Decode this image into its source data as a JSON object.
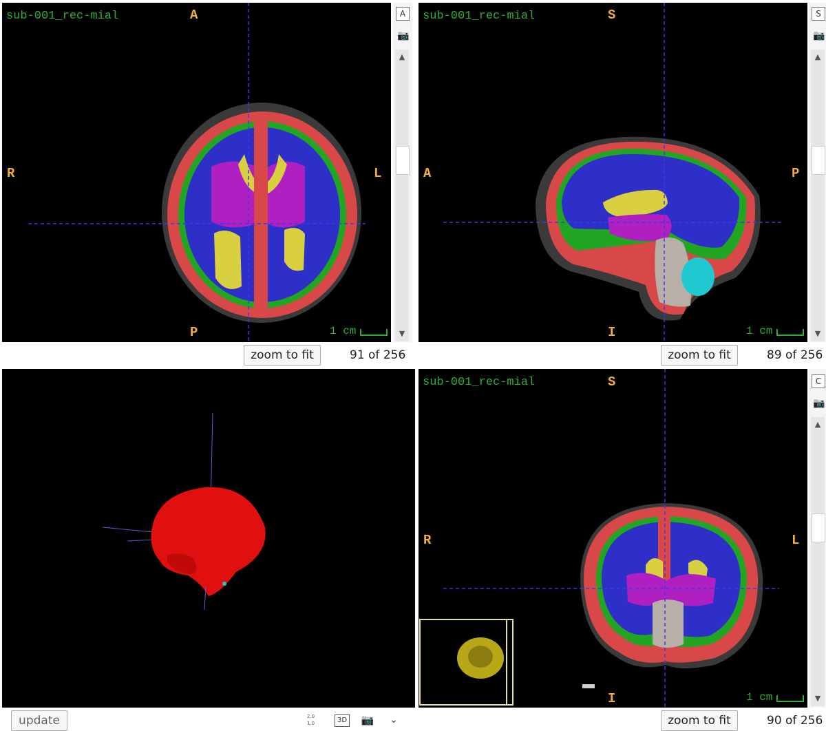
{
  "views": {
    "axial": {
      "title": "sub-001_rec-mial",
      "orient": {
        "top": "A",
        "bottom": "P",
        "left": "R",
        "right": "L"
      },
      "scale_label": "1 cm",
      "side_button": "A",
      "camera_icon": "camera-icon",
      "zoom_label": "zoom to fit",
      "slice": "91 of 256"
    },
    "sagittal": {
      "title": "sub-001_rec-mial",
      "orient": {
        "top": "S",
        "bottom": "I",
        "left": "A",
        "right": "P"
      },
      "scale_label": "1 cm",
      "side_button": "S",
      "camera_icon": "camera-icon",
      "zoom_label": "zoom to fit",
      "slice": "89 of 256"
    },
    "coronal": {
      "title": "sub-001_rec-mial",
      "orient": {
        "top": "S",
        "bottom": "I",
        "left": "R",
        "right": "L"
      },
      "scale_label": "1 cm",
      "side_button": "C",
      "camera_icon": "camera-icon",
      "zoom_label": "zoom to fit",
      "slice": "90 of 256"
    },
    "render3d": {
      "update_label": "update",
      "toolbar_icons": [
        "opacity-scale-icon",
        "3d-view-icon",
        "camera-icon",
        "chevron-down-icon"
      ],
      "opacity_ticks": [
        "2.0",
        "1.0"
      ],
      "view3d_label": "3D"
    }
  },
  "colors": {
    "crosshair": "#3a3adf",
    "label_green": "#2fae2f",
    "orient_yellow": "#f0b030",
    "red": "#d94848",
    "blue": "#2e2ec8",
    "green": "#22a522",
    "magenta": "#b020c0",
    "yellow": "#d8d040",
    "cyan": "#20c8d0",
    "grey": "#b8b0a8"
  }
}
